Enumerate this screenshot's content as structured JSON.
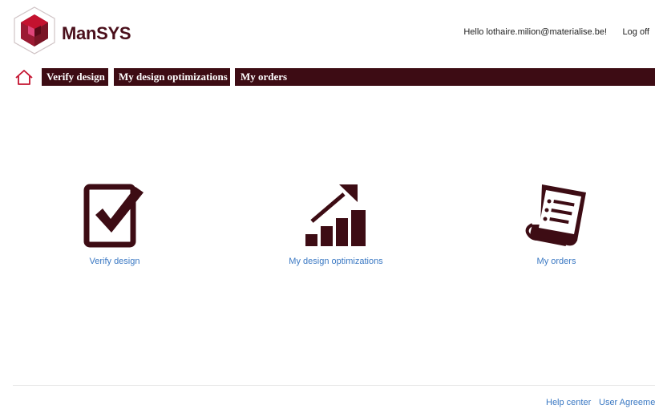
{
  "header": {
    "brand": "ManSYS",
    "greeting": "Hello lothaire.milion@materialise.be!",
    "logoff_label": "Log off"
  },
  "nav": {
    "home_icon": "home-icon",
    "items": [
      {
        "label": "Verify design"
      },
      {
        "label": "My design optimizations"
      },
      {
        "label": "My orders"
      }
    ]
  },
  "tiles": [
    {
      "label": "Verify design",
      "icon": "checkbox-icon"
    },
    {
      "label": "My design optimizations",
      "icon": "growth-chart-icon"
    },
    {
      "label": "My orders",
      "icon": "document-list-icon"
    }
  ],
  "footer": {
    "help_label": "Help center",
    "agreement_label": "User Agreemen"
  },
  "colors": {
    "brand_dark": "#3d0c14",
    "link_blue": "#3a78c3",
    "logo_red": "#c4122f"
  }
}
